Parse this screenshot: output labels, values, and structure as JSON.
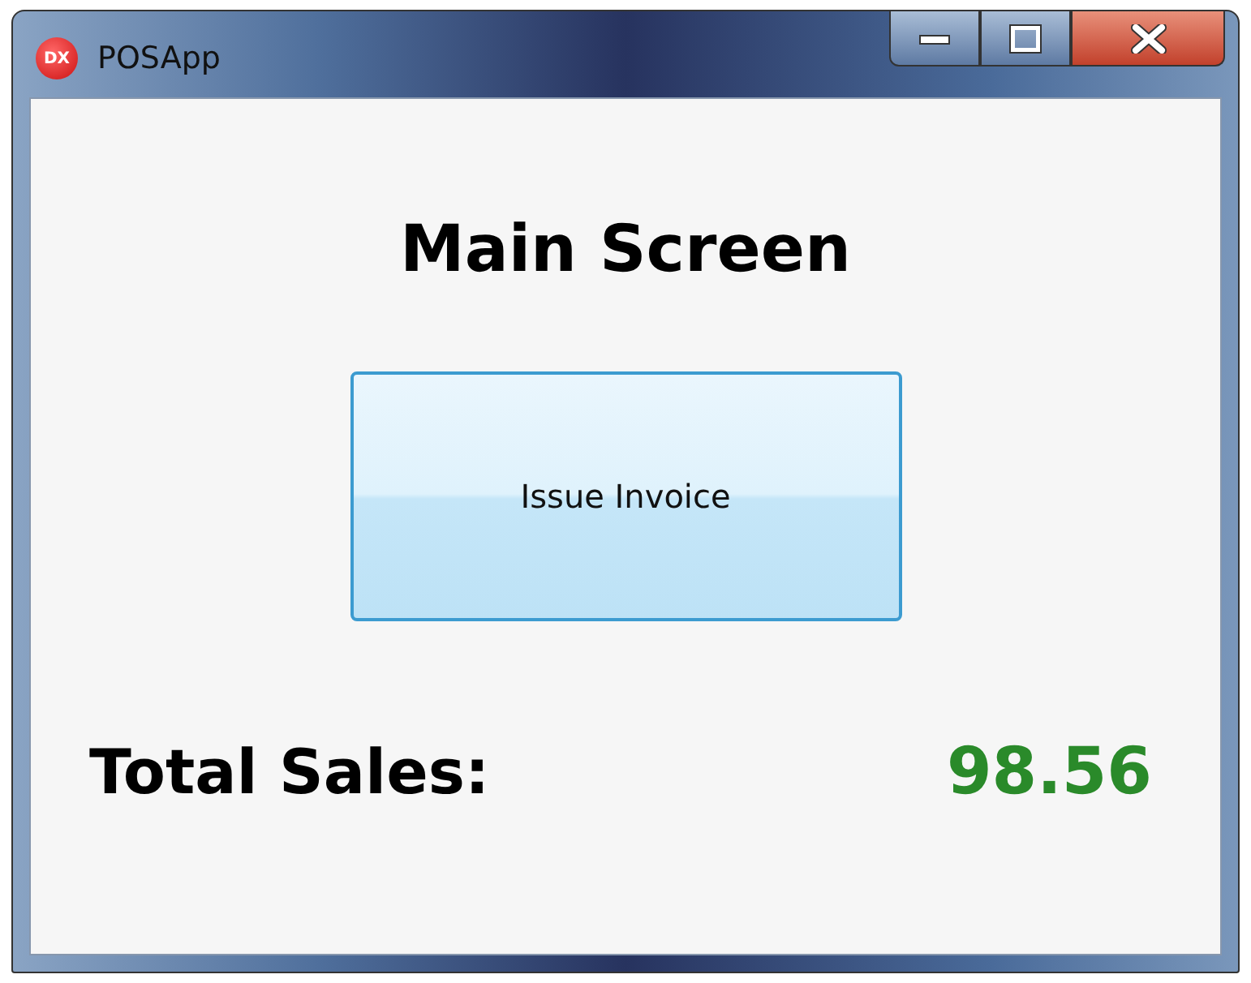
{
  "window": {
    "title": "POSApp",
    "icon_text": "DX"
  },
  "heading": "Main Screen",
  "button": {
    "label": "Issue Invoice"
  },
  "total": {
    "label": "Total Sales:",
    "value": "98.56"
  }
}
